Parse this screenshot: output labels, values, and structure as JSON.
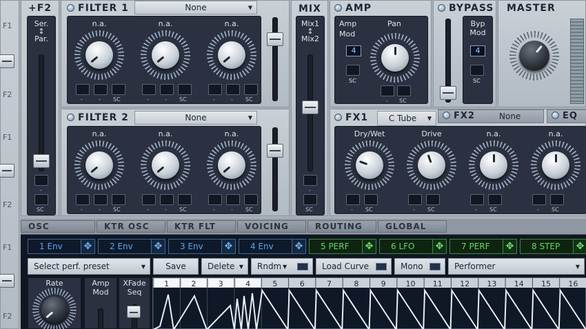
{
  "left_rail": {
    "labels": [
      "F1",
      "F2",
      "F1",
      "F2",
      "F1",
      "F2"
    ]
  },
  "routing": {
    "title": "+F2",
    "mode_top": "Ser.",
    "mode_arrow": "↕",
    "mode_bottom": "Par.",
    "sc": "SC"
  },
  "filter1": {
    "title": "FILTER 1",
    "type": "None",
    "knobs": [
      "n.a.",
      "n.a.",
      "n.a."
    ],
    "footer": [
      "-",
      "-",
      "SC",
      "-",
      "-",
      "SC",
      "-",
      "-",
      "SC"
    ]
  },
  "filter2": {
    "title": "FILTER 2",
    "type": "None",
    "knobs": [
      "n.a.",
      "n.a.",
      "n.a."
    ],
    "footer": [
      "-",
      "-",
      "SC",
      "-",
      "-",
      "SC",
      "-",
      "-",
      "SC"
    ]
  },
  "mix": {
    "title": "MIX",
    "top": "Mix1",
    "arrow": "↕",
    "bottom": "Mix2",
    "sc": "SC"
  },
  "amp": {
    "title": "AMP",
    "mod_label_1": "Amp",
    "mod_label_2": "Mod",
    "mod_value": "4",
    "pan_label": "Pan",
    "sc": "SC",
    "footer": [
      "-",
      "SC"
    ]
  },
  "bypass": {
    "title": "BYPASS",
    "mod_label_1": "Byp",
    "mod_label_2": "Mod",
    "mod_value": "4",
    "sc": "SC"
  },
  "master": {
    "title": "MASTER"
  },
  "fx": {
    "fx1": "FX1",
    "fx1_type": "C Tube",
    "fx2": "FX2",
    "fx2_type": "None",
    "eq": "EQ",
    "knobs": [
      "Dry/Wet",
      "Drive",
      "n.a.",
      "n.a."
    ],
    "footer": [
      "-",
      "SC",
      "-",
      "SC",
      "-",
      "SC",
      "-",
      "SC"
    ]
  },
  "tabs": [
    "OSC",
    "KTR OSC",
    "KTR FLT",
    "VOICING",
    "ROUTING",
    "GLOBAL"
  ],
  "mod_buttons": [
    {
      "label": "1 Env",
      "type": "blue"
    },
    {
      "label": "2 Env",
      "type": "blue"
    },
    {
      "label": "3 Env",
      "type": "blue"
    },
    {
      "label": "4 Env",
      "type": "blue"
    },
    {
      "label": "5 PERF",
      "type": "green"
    },
    {
      "label": "6 LFO",
      "type": "green"
    },
    {
      "label": "7 PERF",
      "type": "green"
    },
    {
      "label": "8 STEP",
      "type": "green"
    }
  ],
  "toolbar": {
    "preset": "Select perf. preset",
    "save": "Save",
    "delete": "Delete",
    "rndm": "Rndm",
    "load_curve": "Load Curve",
    "mono": "Mono",
    "performer": "Performer"
  },
  "perf": {
    "rate": "Rate",
    "amp_1": "Amp",
    "amp_2": "Mod",
    "xfade_1": "XFade",
    "xfade_2": "Seq",
    "steps": [
      "1",
      "2",
      "3",
      "4",
      "5",
      "6",
      "7",
      "8",
      "9",
      "10",
      "11",
      "12",
      "13",
      "14",
      "15",
      "16"
    ]
  },
  "colors": {
    "panel_dark": "#2b3140",
    "blue_accent": "#5aa6f0",
    "green_accent": "#5fd95f",
    "perf_bg": "#0e1826"
  }
}
